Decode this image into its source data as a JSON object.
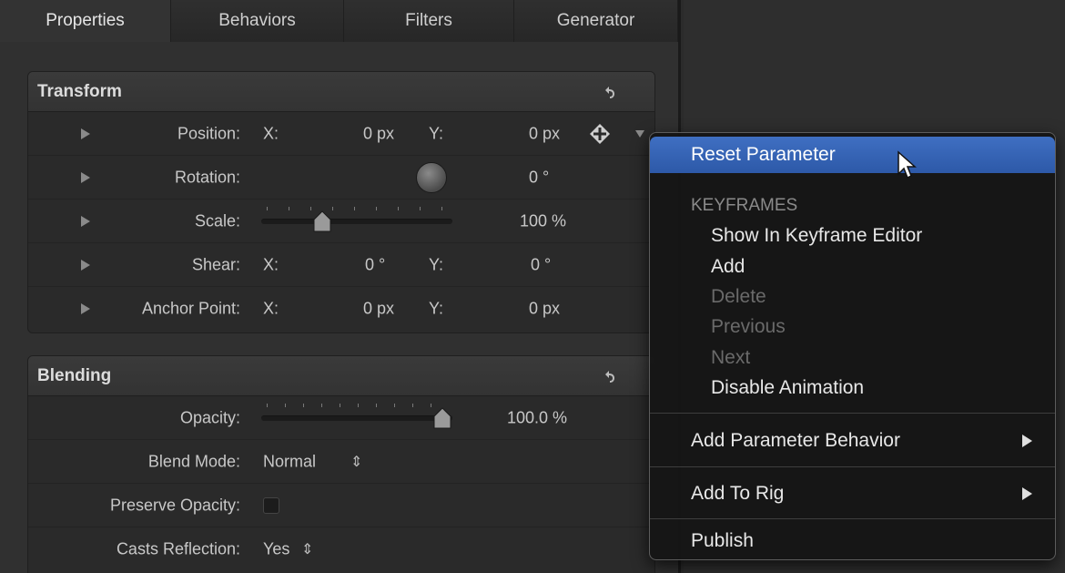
{
  "tabs": [
    {
      "label": "Properties"
    },
    {
      "label": "Behaviors"
    },
    {
      "label": "Filters"
    },
    {
      "label": "Generator"
    }
  ],
  "transform": {
    "title": "Transform",
    "position": {
      "label": "Position:",
      "x_axis": "X:",
      "x_value": "0 px",
      "y_axis": "Y:",
      "y_value": "0 px"
    },
    "rotation": {
      "label": "Rotation:",
      "value": "0 °"
    },
    "scale": {
      "label": "Scale:",
      "value": "100 %",
      "slider_fraction": 0.3
    },
    "shear": {
      "label": "Shear:",
      "x_axis": "X:",
      "x_value": "0 °",
      "y_axis": "Y:",
      "y_value": "0 °"
    },
    "anchor": {
      "label": "Anchor Point:",
      "x_axis": "X:",
      "x_value": "0 px",
      "y_axis": "Y:",
      "y_value": "0 px"
    }
  },
  "blending": {
    "title": "Blending",
    "opacity": {
      "label": "Opacity:",
      "value": "100.0 %",
      "slider_fraction": 1.0
    },
    "blend_mode": {
      "label": "Blend Mode:",
      "value": "Normal"
    },
    "preserve_opacity": {
      "label": "Preserve Opacity:",
      "checked": false
    },
    "casts_reflection": {
      "label": "Casts Reflection:",
      "value": "Yes"
    }
  },
  "context_menu": {
    "reset": "Reset Parameter",
    "keyframes_header": "KEYFRAMES",
    "show_in_editor": "Show In Keyframe Editor",
    "add": "Add",
    "delete": "Delete",
    "previous": "Previous",
    "next": "Next",
    "disable_animation": "Disable Animation",
    "add_param_behavior": "Add Parameter Behavior",
    "add_to_rig": "Add To Rig",
    "publish": "Publish"
  },
  "colors": {
    "highlight": "#3a67b8",
    "panel": "#303030",
    "menu_bg": "#161616"
  },
  "icons": {
    "reset": "reset-arrow-icon",
    "keyframe": "keyframe-diamond-icon",
    "animation_menu": "chevron-down-icon",
    "cursor": "mouse-pointer-icon"
  }
}
